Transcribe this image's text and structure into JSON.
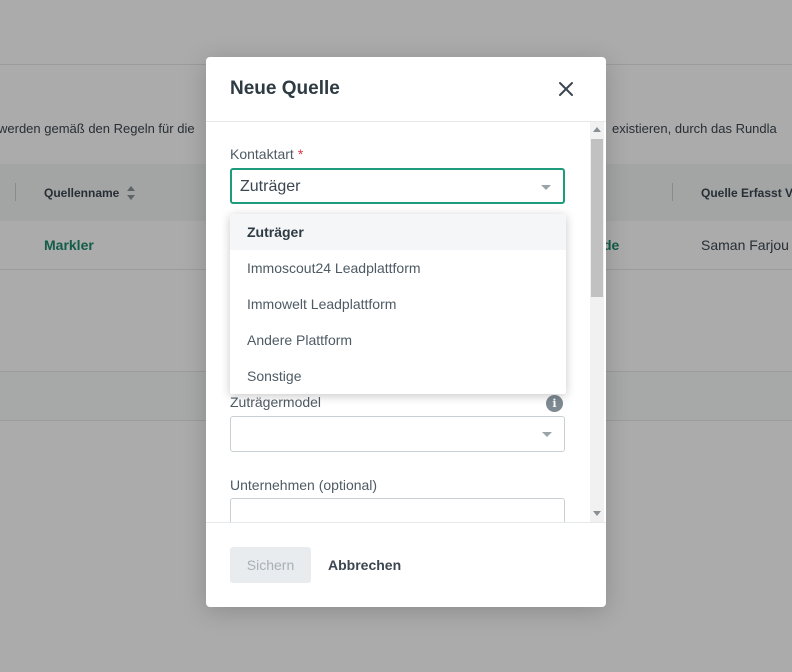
{
  "background": {
    "info_text_left": "werden gemäß den Regeln für die",
    "info_text_right": "existieren, durch das Rundla",
    "table": {
      "columns": [
        "Quellenname",
        "Quelle Erfasst Vo"
      ],
      "row": {
        "name": "Markler",
        "partial_link": "de",
        "created_by": "Saman Farjou"
      }
    }
  },
  "modal": {
    "title": "Neue Quelle",
    "contact_type": {
      "label": "Kontaktart",
      "required_mark": "*",
      "value": "Zuträger",
      "options": [
        "Zuträger",
        "Immoscout24 Leadplattform",
        "Immowelt Leadplattform",
        "Andere Plattform",
        "Sonstige"
      ],
      "selected_index": 0
    },
    "supplier_model": {
      "label": "Zuträgermodel",
      "info_glyph": "i",
      "value": ""
    },
    "company": {
      "label": "Unternehmen (optional)",
      "value": ""
    },
    "footer": {
      "save_label": "Sichern",
      "cancel_label": "Abbrechen"
    }
  },
  "colors": {
    "accent": "#1e9b7d",
    "link": "#1c8a6e",
    "required": "#e0383e"
  }
}
